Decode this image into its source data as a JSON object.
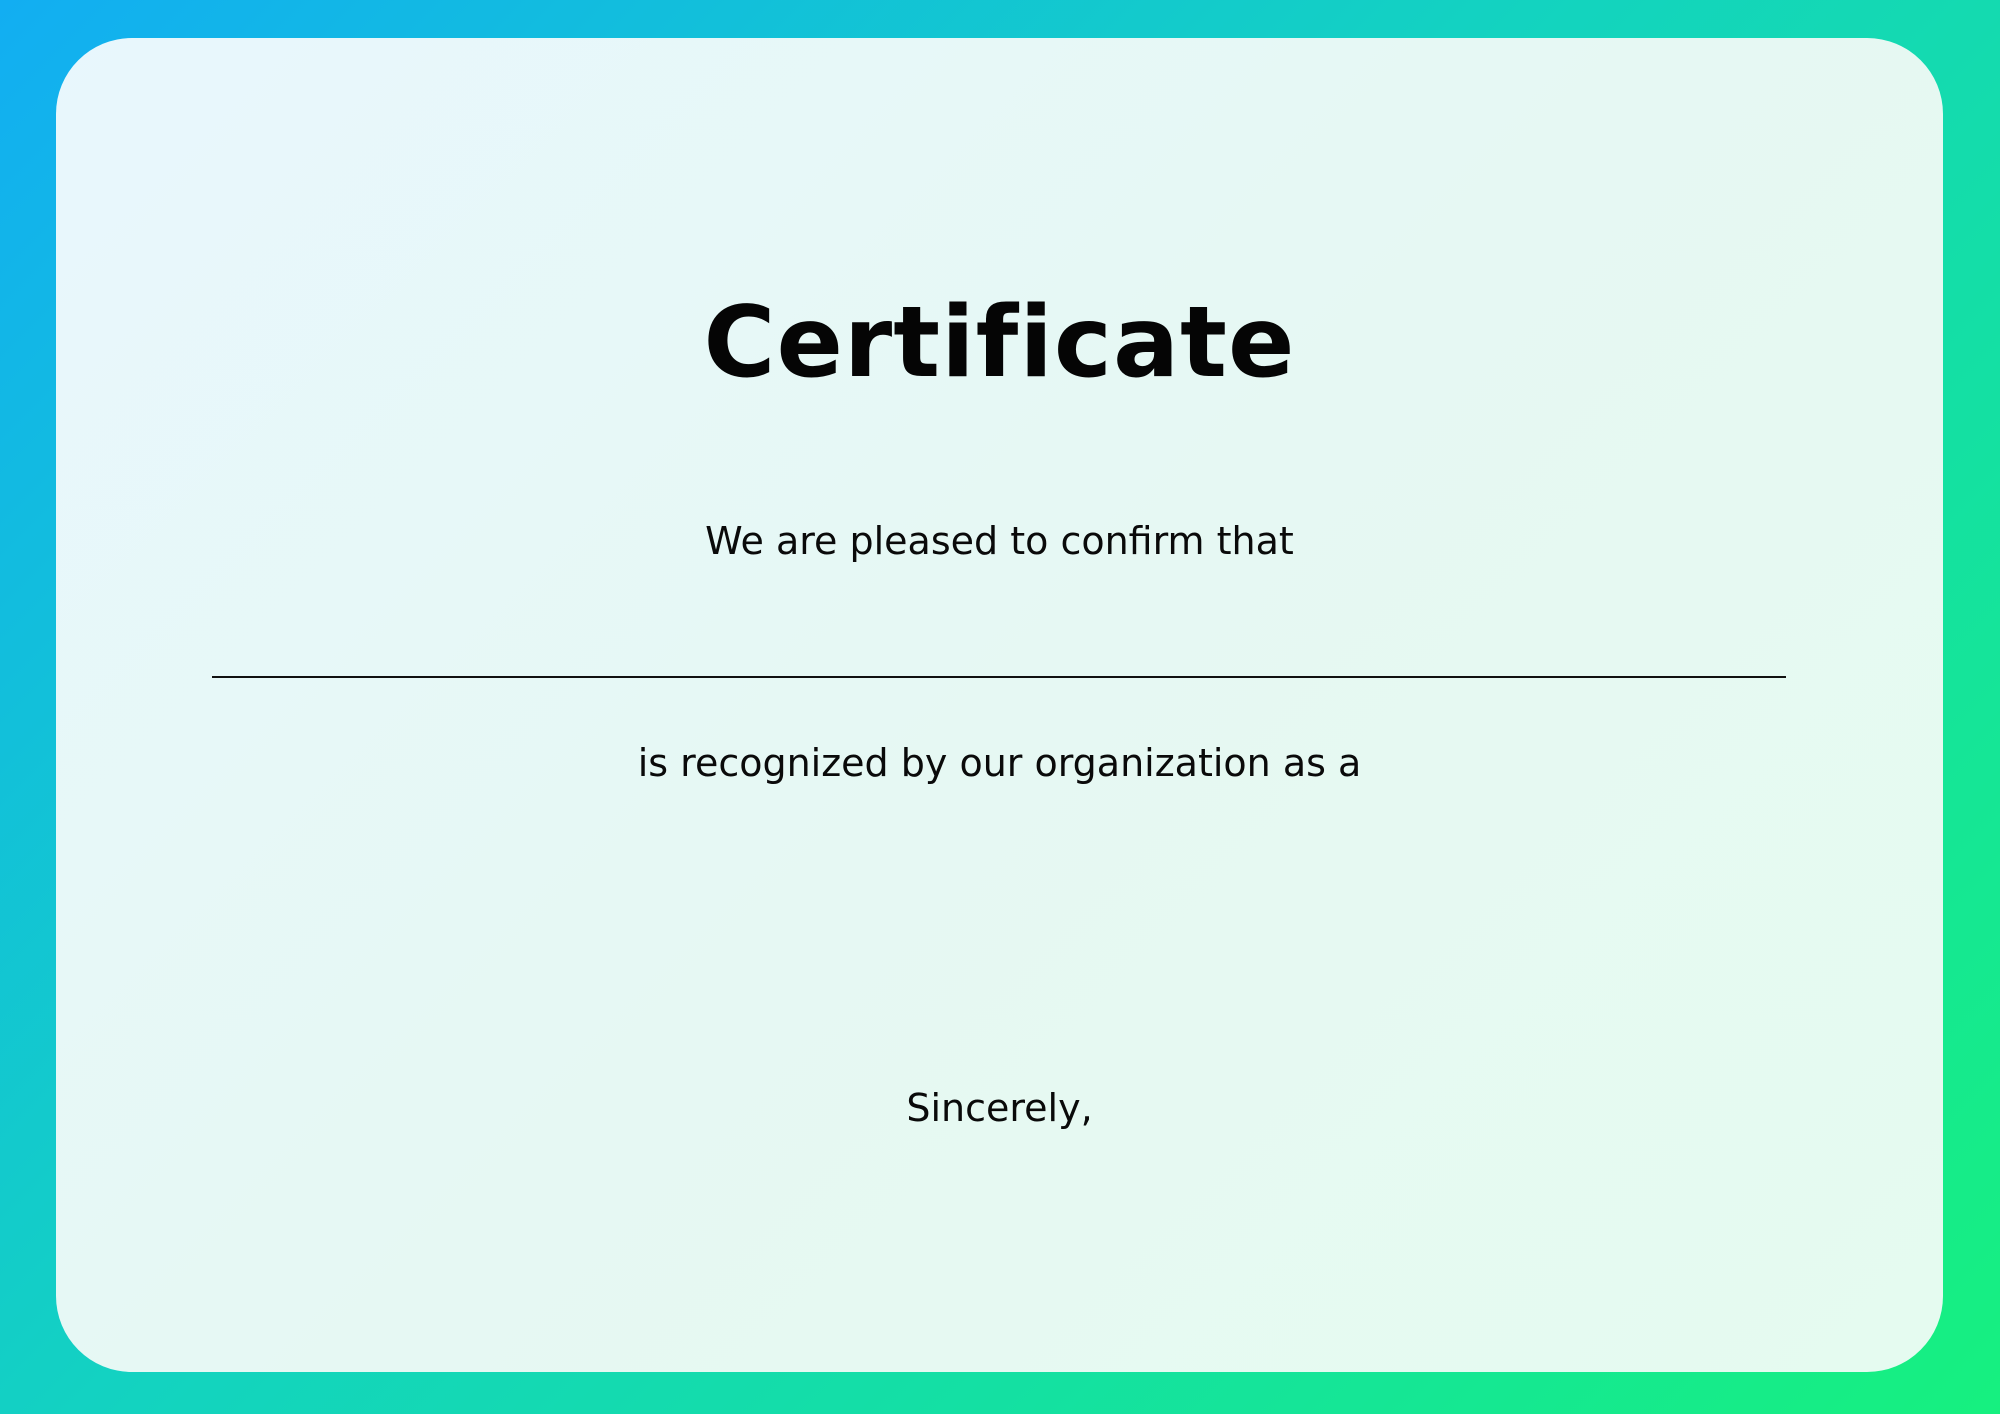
{
  "certificate": {
    "title": "Certificate",
    "intro_text": "We are pleased to confirm that",
    "recognition_text": "is recognized by our organization as a",
    "closing_text": "Sincerely,"
  },
  "colors": {
    "background_gradient_start": "#12aef2",
    "background_gradient_end": "#16f07f",
    "card_background": "#e7f8f6",
    "text": "#0a0a0a"
  }
}
